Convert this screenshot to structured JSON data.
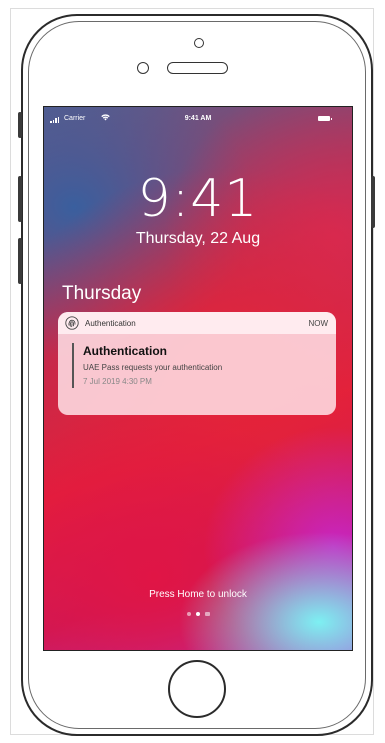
{
  "status_bar": {
    "carrier": "Carrier",
    "time": "9:41 AM",
    "wifi_icon": "wifi-icon",
    "battery_icon": "battery-icon",
    "signal_icon": "signal-icon"
  },
  "lock_screen": {
    "clock": "9:41",
    "date": "Thursday, 22 Aug",
    "day_header": "Thursday",
    "unlock_hint": "Press Home to unlock"
  },
  "notification": {
    "app_icon": "fingerprint-icon",
    "app_name": "Authentication",
    "time": "NOW",
    "title": "Authentication",
    "message": "UAE Pass requests your authentication",
    "date": "7 Jul 2019 4:30 PM"
  },
  "colors": {
    "wallpaper_primary": "#e41f3a",
    "wallpaper_secondary": "#b234c8",
    "wallpaper_accent": "#7df0f2",
    "notification_bg": "#ffe2e8"
  }
}
